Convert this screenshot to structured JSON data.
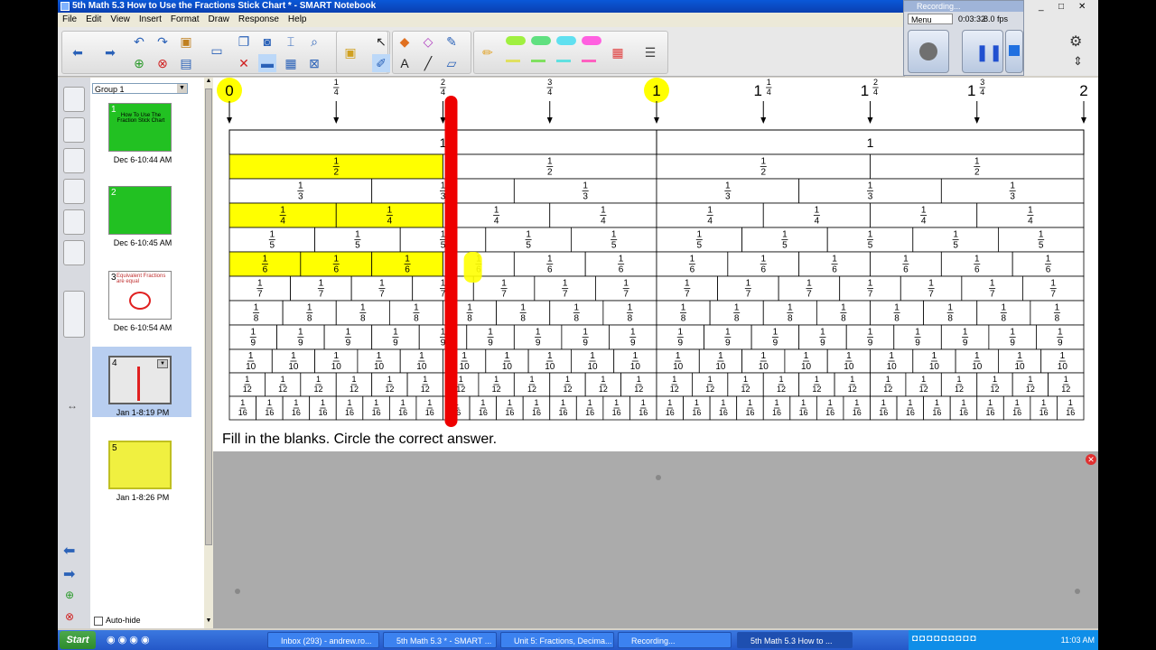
{
  "window": {
    "title": "5th Math 5.3 How to Use the Fractions Stick Chart * - SMART Notebook"
  },
  "menu": [
    "File",
    "Edit",
    "View",
    "Insert",
    "Format",
    "Draw",
    "Response",
    "Help"
  ],
  "recorder": {
    "title": "Recording...",
    "menu_label": "Menu",
    "time": "0:03:32",
    "fps": "8.0 fps"
  },
  "sorter": {
    "group": "Group 1",
    "pages": [
      {
        "num": "1",
        "label": "Dec 6-10:44 AM",
        "text": "How To Use The Fraction Stick Chart"
      },
      {
        "num": "2",
        "label": "Dec 6-10:45 AM",
        "text": ""
      },
      {
        "num": "3",
        "label": "Dec 6-10:54 AM",
        "text": "Equivalent Fractions are equal"
      },
      {
        "num": "4",
        "label": "Jan 1-8:19 PM",
        "text": ""
      },
      {
        "num": "5",
        "label": "Jan 1-8:26 PM",
        "text": ""
      }
    ],
    "auto_hide": "Auto-hide"
  },
  "chart": {
    "number_line": [
      {
        "label": "0",
        "value": 0
      },
      {
        "label": "1/4",
        "value": 0.25
      },
      {
        "label": "2/4",
        "value": 0.5
      },
      {
        "label": "3/4",
        "value": 0.75
      },
      {
        "label": "1",
        "value": 1
      },
      {
        "label": "1 1/4",
        "value": 1.25
      },
      {
        "label": "1 2/4",
        "value": 1.5
      },
      {
        "label": "1 3/4",
        "value": 1.75
      },
      {
        "label": "2",
        "value": 2
      }
    ],
    "whole_label": "1",
    "denominators": [
      2,
      3,
      4,
      5,
      6,
      7,
      8,
      9,
      10,
      12,
      16
    ],
    "highlighted": [
      {
        "den": 2,
        "count": 1
      },
      {
        "den": 4,
        "count": 2
      },
      {
        "den": 6,
        "count": 3
      }
    ],
    "instruction": "Fill in the blanks. Circle the correct answer.",
    "highlight_color": "#ffff00",
    "marker_color": "#ee0000"
  },
  "taskbar": {
    "start": "Start",
    "tasks": [
      "Inbox (293) - andrew.ro...",
      "5th Math 5.3 * - SMART ...",
      "Unit 5: Fractions, Decima...",
      "Recording...",
      "5th Math 5.3 How to ..."
    ],
    "clock": "11:03 AM"
  }
}
